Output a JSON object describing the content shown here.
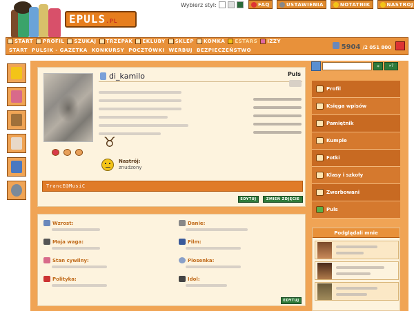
{
  "header": {
    "logo_text": "EPULS",
    "logo_suffix": ".PL",
    "style_label": "Wybierz styl:",
    "style_swatches": [
      "#ffffff",
      "#e0e0e0",
      "#2a6a3a"
    ],
    "top_links": [
      "FAQ",
      "USTAWIENIA",
      "NOTATNIK",
      "NASTROJ"
    ]
  },
  "nav": {
    "main": [
      "START",
      "PROFIL",
      "SZUKAJ",
      "TRZEPAK",
      "EKLUBY",
      "SKLEP",
      "KOMKA",
      "ESTARS",
      "IZZY"
    ],
    "sub": [
      "START",
      "PULSIK - GAZETKA",
      "KONKURSY",
      "POCZTÓWKI",
      "WERBUJ",
      "BEZPIECZEŃSTWO"
    ],
    "points": "5904",
    "points_sub": "/2 051 800"
  },
  "profile": {
    "username": "di_kamilo",
    "puls_label": "Puls",
    "mood_label": "Nastrój:",
    "mood_value": "znudzony",
    "status_text": "TrancE@MusiC",
    "edit_button": "EDYTUJ",
    "change_photo_button": "ZMIEŃ ZDJĘCIE"
  },
  "details": {
    "fields_left": [
      "Wzrost:",
      "Moja waga:",
      "Stan cywilny:",
      "Polityka:"
    ],
    "fields_right": [
      "Danie:",
      "Film:",
      "Piosenka:",
      "Idol:"
    ],
    "edit_button": "EDYTUJ"
  },
  "sidebar": {
    "search_go": "»",
    "search_adv": "»?",
    "menu": [
      "Profil",
      "Księga wpisów",
      "Pamiętnik",
      "Kumple",
      "Fotki",
      "Klasy i szkoły",
      "Zwerbowani",
      "Puls"
    ],
    "visitors_title": "Podglądali mnie"
  }
}
